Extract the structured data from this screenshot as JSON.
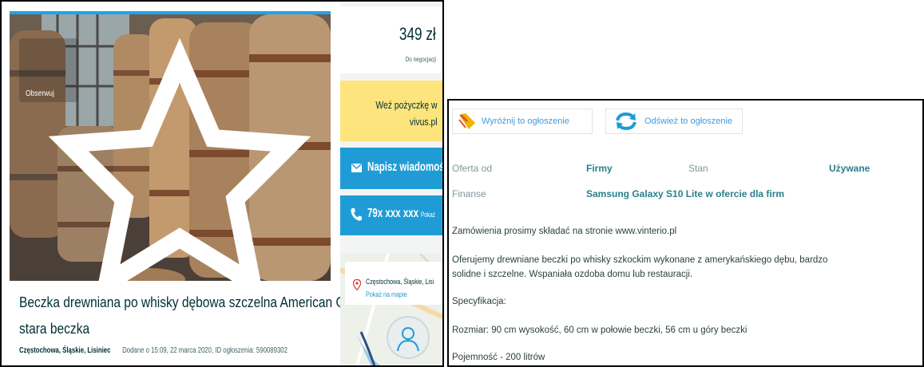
{
  "listing": {
    "follow_label": "Obserwuj",
    "title_line1": "Beczka drewniana po whisky dębowa szczelna American Oak",
    "title_line2": "stara beczka",
    "location": "Częstochowa, Śląskie, Lisiniec",
    "added_info": "Dodane o 15:09, 22 marca 2020, ID ogłoszenia: 590089302"
  },
  "sidebar": {
    "price": "349 zł",
    "negotiable": "Do negocjacji",
    "loan_line1": "Weź pożyczkę w",
    "loan_line2": "vivus.pl",
    "message_label": "Napisz wiadomość",
    "phone_number": "79x xxx xxx",
    "phone_show": "Pokaż",
    "map_location": "Częstochowa, Śląskie, Lisi",
    "map_link": "Pokaż na mapie"
  },
  "actions": {
    "highlight_label": "Wyróżnij to ogłoszenie",
    "refresh_label": "Odśwież to ogłoszenie"
  },
  "params": {
    "offer_from_label": "Oferta od",
    "offer_from_value": "Firmy",
    "condition_label": "Stan",
    "condition_value": "Używane",
    "finance_label": "Finanse",
    "finance_value": "Samsung Galaxy S10 Lite w ofercie dla firm"
  },
  "description": {
    "line1": "Zamówienia prosimy składać na stronie www.vinterio.pl",
    "line2": "Oferujemy drewniane beczki po whisky szkockim wykonane z amerykańskiego dębu, bardzo",
    "line3": "solidne i szczelne. Wspaniała ozdoba domu lub restauracji.",
    "line4": "Specyfikacja:",
    "line5": "Rozmiar: 90 cm wysokość, 60 cm w połowie beczki, 56 cm u góry beczki",
    "line6": "Pojemność - 200 litrów"
  },
  "colors": {
    "accent_blue": "#1f9cd6",
    "loan_yellow": "#fde47c",
    "param_value": "#2a7f8a",
    "text_dark": "#002f34"
  }
}
